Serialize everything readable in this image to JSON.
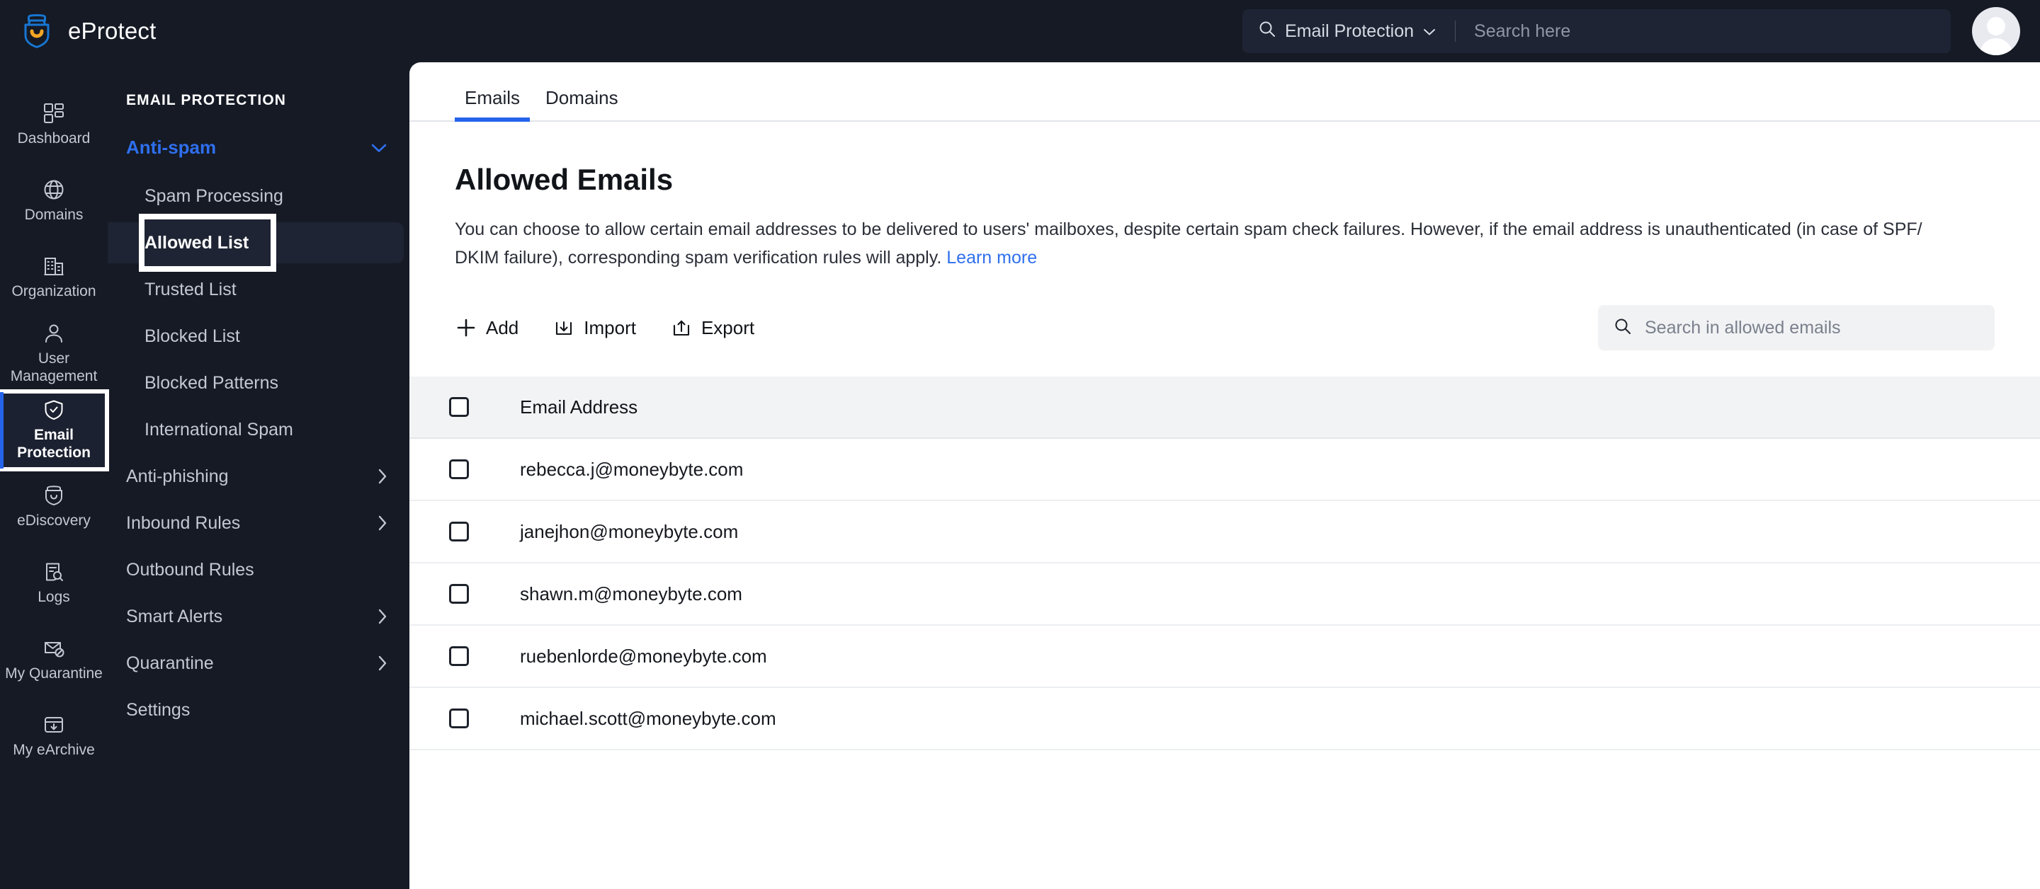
{
  "app": {
    "brand_name": "eProtect",
    "logo_icon": "shield-helmet-logo",
    "colors": {
      "dark_bg": "#151a25",
      "panel_bg": "#ffffff",
      "accent_blue": "#2563eb",
      "link_blue": "#2f6fed",
      "logo_blue": "#1876d2",
      "logo_yellow": "#f5a623",
      "muted_text": "#c3c8d4"
    }
  },
  "topbar": {
    "search_scope_label": "Email Protection",
    "search_scope_icon": "search-icon",
    "search_scope_chevron": "chevron-down-icon",
    "search_placeholder": "Search here",
    "search_value": "",
    "avatar_icon": "user-avatar"
  },
  "rail": {
    "items": [
      {
        "label": "Dashboard",
        "icon": "dashboard-grid-icon",
        "active": false
      },
      {
        "label": "Domains",
        "icon": "globe-icon",
        "active": false
      },
      {
        "label": "Organization",
        "icon": "building-icon",
        "active": false
      },
      {
        "label": "User Management",
        "icon": "person-icon",
        "active": false
      },
      {
        "label": "Email Protection",
        "icon": "shield-check-icon",
        "active": true
      },
      {
        "label": "eDiscovery",
        "icon": "helmet-icon",
        "active": false
      },
      {
        "label": "Logs",
        "icon": "document-search-icon",
        "active": false
      },
      {
        "label": "My Quarantine",
        "icon": "envelope-block-icon",
        "active": false
      },
      {
        "label": "My eArchive",
        "icon": "archive-download-icon",
        "active": false
      }
    ]
  },
  "subnav": {
    "heading": "EMAIL PROTECTION",
    "group": {
      "label": "Anti-spam",
      "chevron": "chevron-down-icon",
      "expanded": true,
      "children": [
        {
          "label": "Spam Processing",
          "selected": false
        },
        {
          "label": "Allowed List",
          "selected": true
        },
        {
          "label": "Trusted List",
          "selected": false
        },
        {
          "label": "Blocked List",
          "selected": false
        },
        {
          "label": "Blocked Patterns",
          "selected": false
        },
        {
          "label": "International Spam",
          "selected": false
        }
      ]
    },
    "items": [
      {
        "label": "Anti-phishing",
        "chevron": "chevron-right-icon"
      },
      {
        "label": "Inbound Rules",
        "chevron": "chevron-right-icon"
      },
      {
        "label": "Outbound Rules",
        "chevron": ""
      },
      {
        "label": "Smart Alerts",
        "chevron": "chevron-right-icon"
      },
      {
        "label": "Quarantine",
        "chevron": "chevron-right-icon"
      },
      {
        "label": "Settings",
        "chevron": ""
      }
    ]
  },
  "main": {
    "tabs": [
      {
        "label": "Emails",
        "active": true
      },
      {
        "label": "Domains",
        "active": false
      }
    ],
    "title": "Allowed Emails",
    "description_part1": "You can choose to allow certain email addresses to be delivered to users' mailboxes, despite certain spam check failures. However, if the email address is unauthenticated (in case of SPF/ DKIM failure), corresponding spam verification rules will apply. ",
    "learn_more_label": "Learn more",
    "toolbar": {
      "add_label": "Add",
      "add_icon": "plus-icon",
      "import_label": "Import",
      "import_icon": "import-tray-down-icon",
      "export_label": "Export",
      "export_icon": "export-tray-up-icon",
      "search_placeholder": "Search in allowed emails",
      "search_value": "",
      "search_icon": "search-icon"
    },
    "table": {
      "select_all_checked": false,
      "columns": [
        "Email Address"
      ],
      "rows": [
        {
          "email": "rebecca.j@moneybyte.com",
          "checked": false
        },
        {
          "email": "janejhon@moneybyte.com",
          "checked": false
        },
        {
          "email": "shawn.m@moneybyte.com",
          "checked": false
        },
        {
          "email": "ruebenlorde@moneybyte.com",
          "checked": false
        },
        {
          "email": "michael.scott@moneybyte.com",
          "checked": false
        }
      ]
    }
  }
}
